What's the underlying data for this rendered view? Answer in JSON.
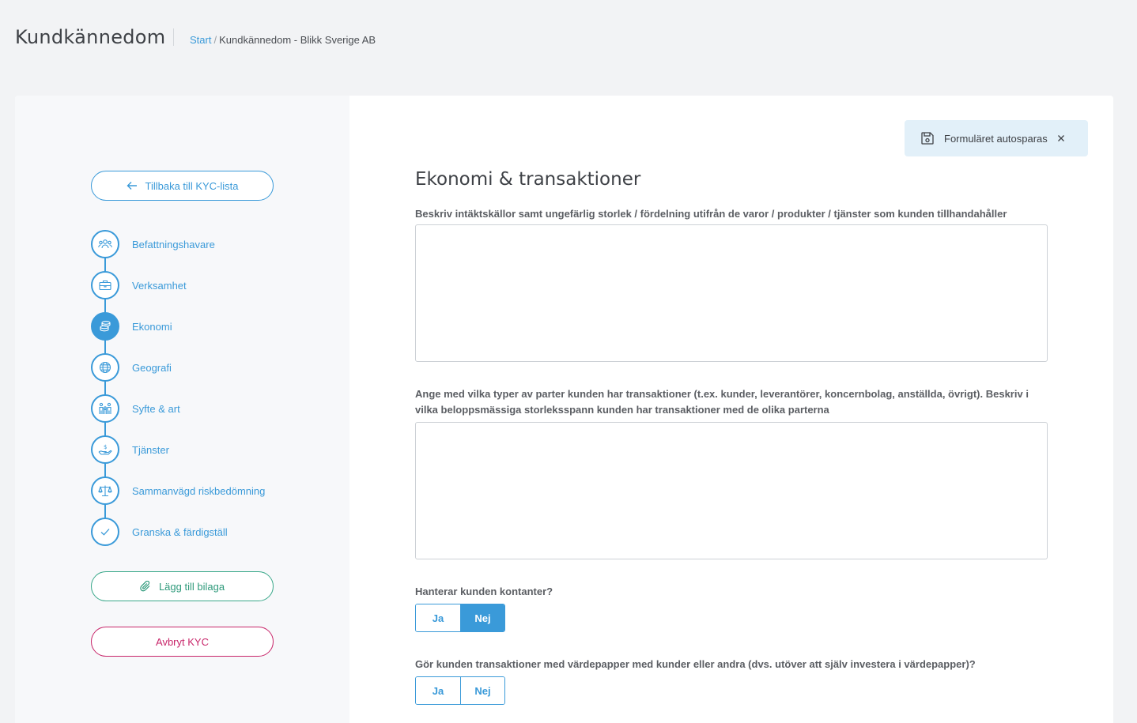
{
  "header": {
    "title": "Kundkännedom",
    "breadcrumb": {
      "start": "Start",
      "separator": "/",
      "current": "Kundkännedom - Blikk Sverige AB"
    }
  },
  "sidebar": {
    "back_label": "Tillbaka till KYC-lista",
    "steps": [
      {
        "label": "Befattningshavare",
        "icon": "people-icon",
        "active": false
      },
      {
        "label": "Verksamhet",
        "icon": "briefcase-icon",
        "active": false
      },
      {
        "label": "Ekonomi",
        "icon": "coins-icon",
        "active": true
      },
      {
        "label": "Geografi",
        "icon": "globe-icon",
        "active": false
      },
      {
        "label": "Syfte & art",
        "icon": "family-icon",
        "active": false
      },
      {
        "label": "Tjänster",
        "icon": "hand-dollar-icon",
        "active": false
      },
      {
        "label": "Sammanvägd riskbedömning",
        "icon": "scales-icon",
        "active": false
      },
      {
        "label": "Granska & färdigställ",
        "icon": "check-icon",
        "active": false
      }
    ],
    "attach_label": "Lägg till bilaga",
    "cancel_label": "Avbryt KYC"
  },
  "main": {
    "autosave": {
      "label": "Formuläret autosparas",
      "icon": "save-icon"
    },
    "section_title": "Ekonomi & transaktioner",
    "fields": [
      {
        "label": "Beskriv intäktskällor samt ungefärlig storlek / fördelning utifrån de varor / produkter / tjänster som kunden tillhandahåller",
        "value": ""
      },
      {
        "label": "Ange med vilka typer av parter kunden har transaktioner (t.ex. kunder, leverantörer, koncernbolag, anställda, övrigt). Beskriv i vilka beloppsmässiga storleksspann kunden har transaktioner med de olika parterna",
        "value": ""
      }
    ],
    "questions": [
      {
        "label": "Hanterar kunden kontanter?",
        "yes": "Ja",
        "no": "Nej",
        "selected": "Nej"
      },
      {
        "label": "Gör kunden transaktioner med värdepapper med kunder eller andra (dvs. utöver att själv investera i värdepapper)?",
        "yes": "Ja",
        "no": "Nej",
        "selected": ""
      }
    ]
  },
  "colors": {
    "accent": "#3a9ad9",
    "attach": "#3aa88a",
    "cancel": "#c8266a",
    "autosave_bg": "#e2f0f9"
  }
}
